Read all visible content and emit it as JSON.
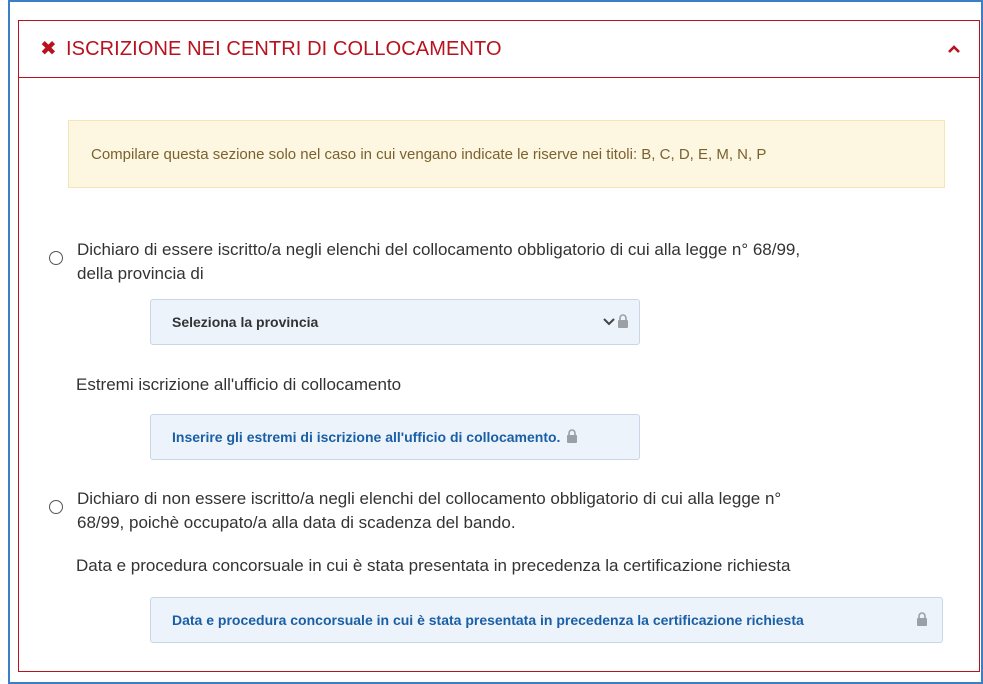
{
  "section": {
    "title": "ISCRIZIONE NEI CENTRI DI COLLOCAMENTO",
    "status_icon": "x-icon",
    "toggle_icon": "chevron-up-icon",
    "accent_color": "#b8121f"
  },
  "notice": {
    "text": "Compilare questa sezione solo nel caso in cui vengano indicate le riserve nei titoli: B, C, D, E, M, N, P"
  },
  "option1": {
    "line1": "Dichiaro di essere iscritto/a negli elenchi del collocamento obbligatorio di cui alla legge n° 68/99,",
    "line2": "della provincia di",
    "select_placeholder": "Seleziona la provincia",
    "sub_label": "Estremi iscrizione all'ufficio di collocamento",
    "input_placeholder": "Inserire gli estremi di iscrizione all'ufficio di collocamento."
  },
  "option2": {
    "line1": "Dichiaro di non essere iscritto/a negli elenchi del collocamento obbligatorio di cui alla legge n°",
    "line2": "68/99, poichè occupato/a alla data di scadenza del bando.",
    "sub_label": "Data e procedura concorsuale in cui è stata presentata in precedenza la certificazione richiesta",
    "input_placeholder": "Data e procedura concorsuale in cui è stata presentata in precedenza la certificazione richiesta"
  }
}
